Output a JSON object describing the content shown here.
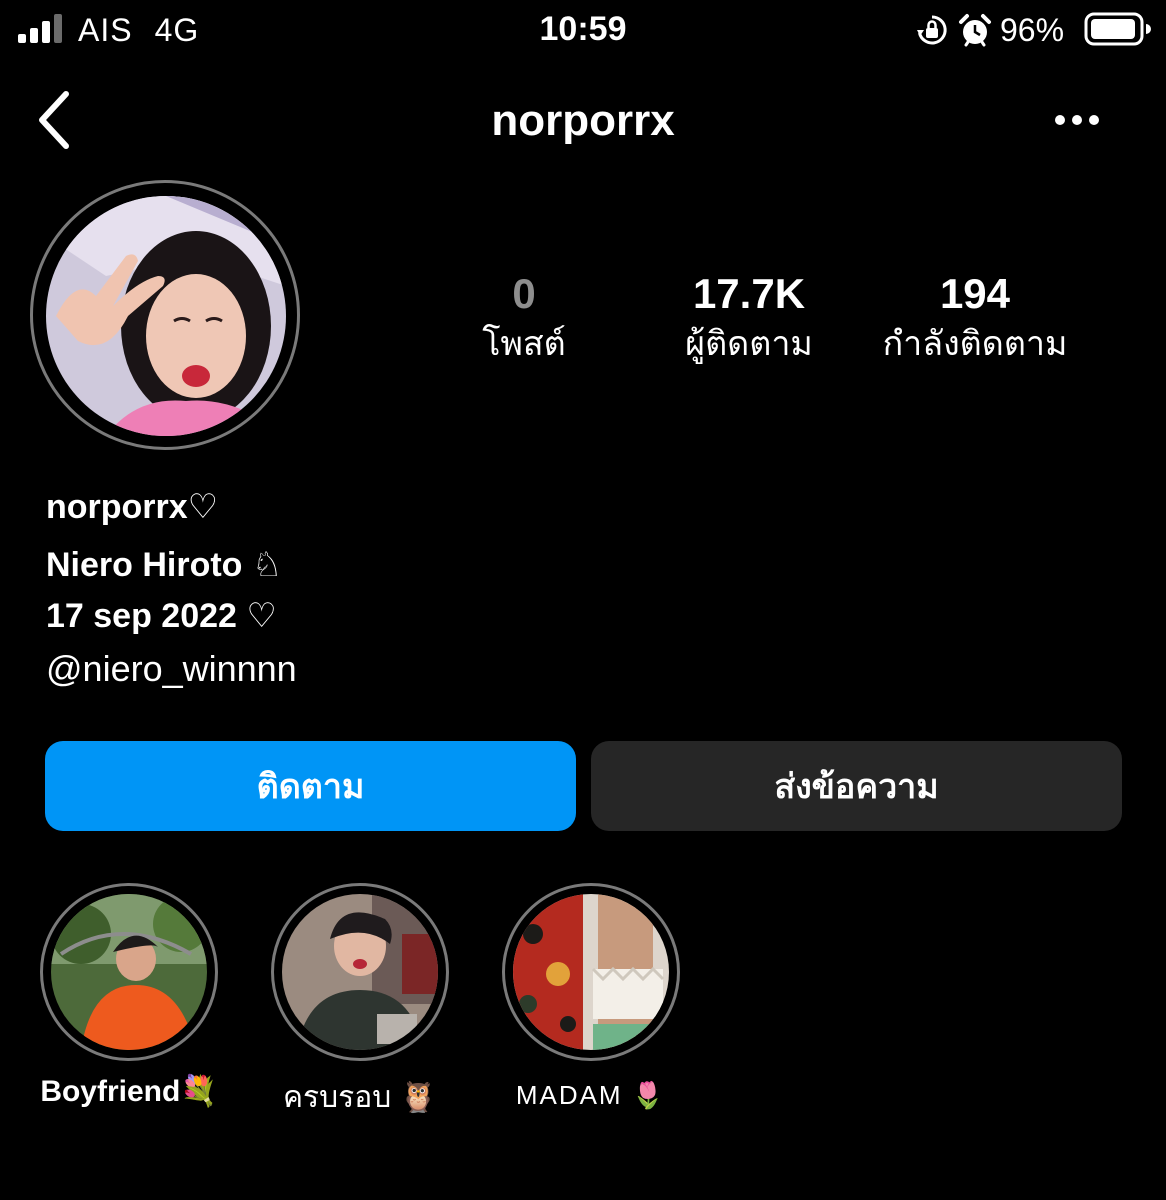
{
  "status_bar": {
    "carrier": "AIS",
    "network": "4G",
    "time": "10:59",
    "battery_percent": "96%",
    "icons": [
      "signal-bars-icon",
      "rotation-lock-icon",
      "alarm-clock-icon",
      "battery-icon"
    ]
  },
  "nav": {
    "title": "norporrx",
    "back_icon": "chevron-left-icon",
    "more_icon": "more-horizontal-icon"
  },
  "stats": {
    "posts": {
      "value": "0",
      "label": "โพสต์"
    },
    "followers": {
      "value": "17.7K",
      "label": "ผู้ติดตาม"
    },
    "following": {
      "value": "194",
      "label": "กำลังติดตาม"
    }
  },
  "bio": {
    "username": "norporrx♡",
    "name": "Niero Hiroto ♘",
    "date": "17 sep 2022 ♡",
    "mention": "@niero_winnnn"
  },
  "buttons": {
    "follow": "ติดตาม",
    "message": "ส่งข้อความ"
  },
  "highlights": [
    {
      "label": "Boyfriend💐"
    },
    {
      "label": "ครบรอบ 🦉"
    },
    {
      "label": "MADAM 🌷"
    }
  ],
  "colors": {
    "background": "#000000",
    "follow_button": "#0095f6",
    "message_button": "#262626",
    "muted_text": "#8e8e8e"
  }
}
